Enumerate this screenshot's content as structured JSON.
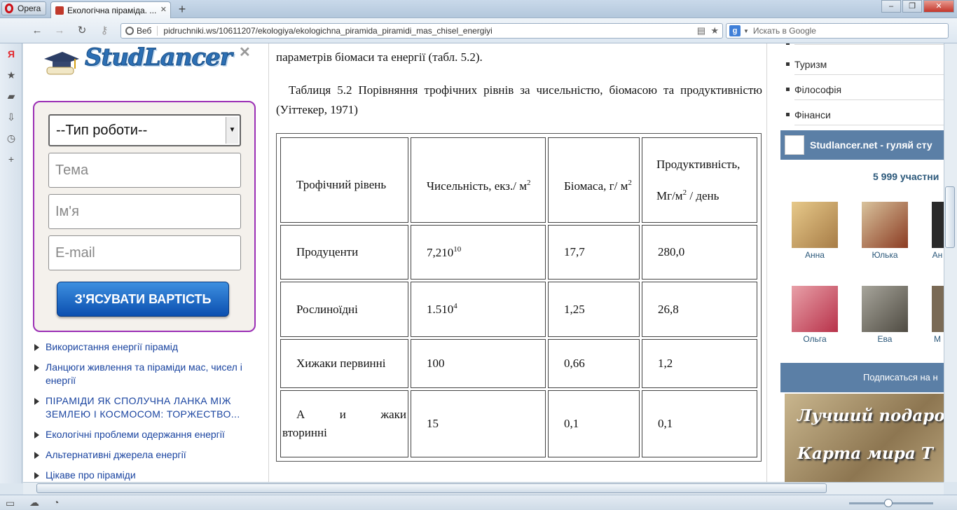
{
  "browser": {
    "menu_label": "Opera",
    "tab_title": "Екологічна піраміда. ...",
    "address": {
      "mode_label": "Веб",
      "url": "pidruchniki.ws/10611207/ekologiya/ekologichna_piramida_piramidi_mas_chisel_energiyi"
    },
    "search_placeholder": "Искать в Google",
    "search_engine": "Google"
  },
  "sidebar": {
    "logo_text": "StudLancer",
    "form": {
      "type_select": "--Тип роботи--",
      "topic_placeholder": "Тема",
      "name_placeholder": "Ім'я",
      "email_placeholder": "E-mail",
      "submit_label": "З'ЯСУВАТИ ВАРТІСТЬ"
    },
    "links": [
      "Використання енергії пірамід",
      "Ланцюги живлення та піраміди мас, чисел і енергії",
      "ПІРАМІДИ ЯК СПОЛУЧНА ЛАНКА МІЖ ЗЕМЛЕЮ І КОСМОСОМ: ТОРЖЕСТВО...",
      "Екологічні проблеми одержання енергії",
      "Альтернативні джерела енергії",
      "Цікаве про піраміди"
    ]
  },
  "article": {
    "top_text": "параметрів біомаси та енергії (табл. 5.2).",
    "caption": "Таблиця 5.2 Порівняння трофічних рівнів за чисельністю, біомасою та продуктивністю (Уіттекер, 1971)",
    "table": {
      "headers": {
        "level": "Трофічний рівень",
        "count_a": "Чисельність, екз./ м",
        "count_b": "2",
        "biomass_a": "Біомаса, г/ м",
        "biomass_b": "2",
        "prod_a": "Продуктивність,",
        "prod_b": "Мг/м",
        "prod_c": "2",
        "prod_d": "/ день"
      },
      "rows": [
        {
          "level": "Продуценти",
          "count": "7,210",
          "count_exp": "10",
          "biomass": "17,7",
          "prod": "280,0"
        },
        {
          "level": "Рослиноїдні",
          "count": "1.510",
          "count_exp": "4",
          "biomass": "1,25",
          "prod": "26,8"
        },
        {
          "level": "Хижаки первинні",
          "count": "100",
          "count_exp": "",
          "biomass": "0,66",
          "prod": "1,2"
        },
        {
          "level": "А и жаки вторинні",
          "count": "15",
          "count_exp": "",
          "biomass": "0,1",
          "prod": "0,1"
        }
      ]
    }
  },
  "rightbar": {
    "categories": [
      "Туризм",
      "Філософія",
      "Фінанси"
    ],
    "vk": {
      "header": "Studlancer.net - гуляй сту",
      "members": "5 999 участни",
      "people": [
        "Анна",
        "Юлька",
        "Ан",
        "Ольга",
        "Ева",
        "М"
      ],
      "subscribe": "Подписаться на н"
    },
    "promo": {
      "line1": "Лучший подарок",
      "line2": "Карта мира Т"
    }
  },
  "colors": {
    "link": "#1a44a0",
    "form_border": "#9b2fb5",
    "button": "#0b4fb0",
    "vk_blue": "#5b7fa6"
  }
}
